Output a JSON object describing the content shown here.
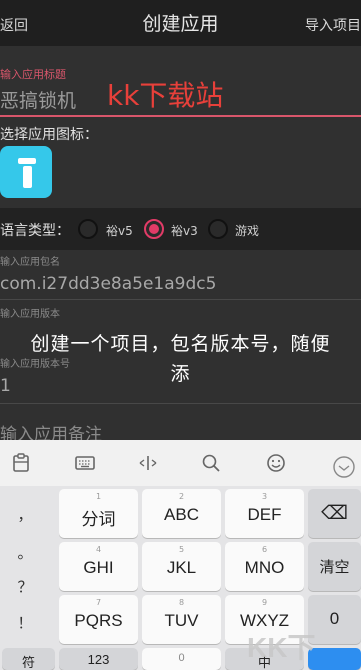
{
  "header": {
    "back": "返回",
    "title": "创建应用",
    "import": "导入项目"
  },
  "form": {
    "title_label": "输入应用标题",
    "title_value": "恶搞锁机",
    "icon_label": "选择应用图标：",
    "lang_label": "语言类型：",
    "lang_options": [
      "裕v5",
      "裕v3",
      "游戏"
    ],
    "package_label": "输入应用包名",
    "package_value": "com.i27dd3e8a5e1a9dc5",
    "version_label": "输入应用版本",
    "version_code_label": "输入应用版本号",
    "version_code_value": "1",
    "remark_placeholder": "输入应用备注"
  },
  "overlay": {
    "line1": "创建一个项目，包名版本号，随便",
    "line2": "添"
  },
  "watermark": {
    "top": "kk下载站",
    "bottom": "KK下"
  },
  "keyboard": {
    "toolbar_icons": [
      "clipboard-icon",
      "keyboard-icon",
      "cursor-icon",
      "search-icon",
      "emoji-icon",
      "collapse-icon"
    ],
    "punct": [
      "，",
      "。",
      "？",
      "！"
    ],
    "row1": [
      {
        "sub": "1",
        "main": "分词"
      },
      {
        "sub": "2",
        "main": "ABC"
      },
      {
        "sub": "3",
        "main": "DEF"
      }
    ],
    "row2": [
      {
        "sub": "4",
        "main": "GHI"
      },
      {
        "sub": "5",
        "main": "JKL"
      },
      {
        "sub": "6",
        "main": "MNO"
      }
    ],
    "row3": [
      {
        "sub": "7",
        "main": "PQRS"
      },
      {
        "sub": "8",
        "main": "TUV"
      },
      {
        "sub": "9",
        "main": "WXYZ"
      }
    ],
    "right": [
      "⌫",
      "清空",
      "0"
    ],
    "bottom": [
      "符",
      "123",
      "0",
      "中"
    ]
  },
  "colors": {
    "accent": "#e23b67",
    "icon_bg": "#35c8ea",
    "watermark": "#e8403a"
  }
}
